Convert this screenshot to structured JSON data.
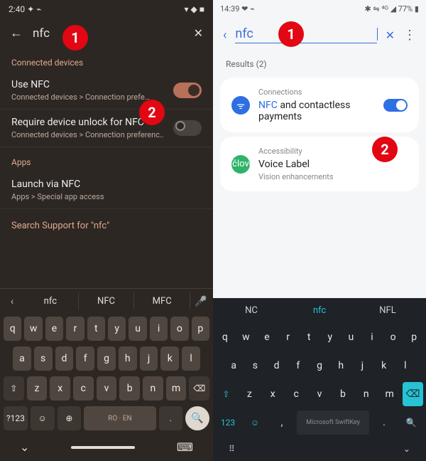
{
  "callouts": {
    "c1": "1",
    "c2": "2"
  },
  "left": {
    "status_time": "2:40",
    "status_icons": "✦ ⌁",
    "status_right": "▾ ◆ ■",
    "search": {
      "query": "nfc"
    },
    "sec_conn": "Connected devices",
    "rows": {
      "useNfc": {
        "title": "Use NFC",
        "sub": "Connected devices > Connection prefe…"
      },
      "requireUnlock": {
        "title": "Require device unlock for NFC",
        "sub": "Connected devices > Connection preferenc.."
      }
    },
    "sec_apps": "Apps",
    "launch": {
      "title": "Launch via NFC",
      "sub": "Apps > Special app access"
    },
    "support": "Search Support for \"nfc\"",
    "sugg": {
      "s1": "nfc",
      "s2": "NFC",
      "s3": "MFC"
    },
    "kb": {
      "r1": [
        "q",
        "w",
        "e",
        "r",
        "t",
        "y",
        "u",
        "i",
        "o",
        "p"
      ],
      "r2": [
        "a",
        "s",
        "d",
        "f",
        "g",
        "h",
        "j",
        "k",
        "l"
      ],
      "r3": [
        "⇧",
        "z",
        "x",
        "c",
        "v",
        "b",
        "n",
        "m",
        "⌫"
      ],
      "r4": {
        "num": "?123",
        "emoji": "☺",
        "lang": "⊕",
        "space": "RO · EN",
        "period": ".",
        "search": "🔍"
      }
    }
  },
  "right": {
    "status_time": "14:39",
    "status_icons": "❤ ⌁",
    "status_right": "✱ ⇋ ⁴ᴳ ◢ 77% ▮",
    "search": {
      "query": "nfc"
    },
    "results_label": "Results (2)",
    "card1": {
      "cat": "Connections",
      "title_hl": "NFC",
      "title_rest": " and contactless payments"
    },
    "card2": {
      "cat": "Accessibility",
      "title": "Voice Label",
      "sub": "Vision enhancements"
    },
    "sugg": {
      "s1": "NC",
      "s2": "nfc",
      "s3": "NFL"
    },
    "kb": {
      "r1": [
        "q",
        "w",
        "e",
        "r",
        "t",
        "y",
        "u",
        "i",
        "o",
        "p"
      ],
      "r2": [
        "a",
        "s",
        "d",
        "f",
        "g",
        "h",
        "j",
        "k",
        "l"
      ],
      "r3": [
        "⇧",
        "z",
        "x",
        "c",
        "v",
        "b",
        "n",
        "m",
        "⌫"
      ],
      "r4": {
        "num": "123",
        "emoji": "☺",
        "comma": ",",
        "space": "Microsoft SwiftKey",
        "period": ".",
        "search": "🔍"
      }
    },
    "nav": {
      "grid": "⠿",
      "down": "⌄"
    }
  }
}
